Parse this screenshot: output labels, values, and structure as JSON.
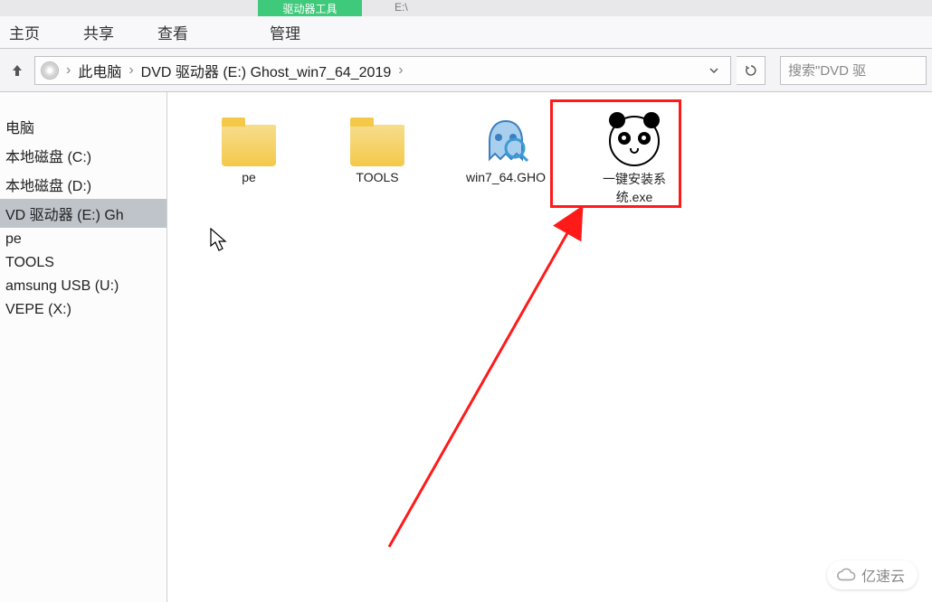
{
  "ribbon": {
    "context_label": "驱动器工具",
    "drive_letter": "E:\\",
    "tabs": {
      "home": "主页",
      "share": "共享",
      "view": "查看",
      "manage": "管理"
    }
  },
  "address": {
    "crumbs": [
      "此电脑",
      "DVD 驱动器 (E:) Ghost_win7_64_2019"
    ]
  },
  "search": {
    "placeholder": "搜索\"DVD 驱"
  },
  "sidebar": {
    "items": [
      {
        "label": "电脑",
        "selected": false
      },
      {
        "label": "本地磁盘 (C:)",
        "selected": false
      },
      {
        "label": "本地磁盘 (D:)",
        "selected": false
      },
      {
        "label": "VD 驱动器 (E:) Gh",
        "selected": true
      },
      {
        "label": "pe",
        "selected": false
      },
      {
        "label": "TOOLS",
        "selected": false
      },
      {
        "label": "amsung USB (U:)",
        "selected": false
      },
      {
        "label": "VEPE (X:)",
        "selected": false
      }
    ]
  },
  "files": [
    {
      "name": "pe",
      "type": "folder"
    },
    {
      "name": "TOOLS",
      "type": "folder"
    },
    {
      "name": "win7_64.GHO",
      "type": "gho"
    },
    {
      "name": "一键安装系统.exe",
      "type": "exe"
    }
  ],
  "watermark": {
    "text": "亿速云"
  }
}
